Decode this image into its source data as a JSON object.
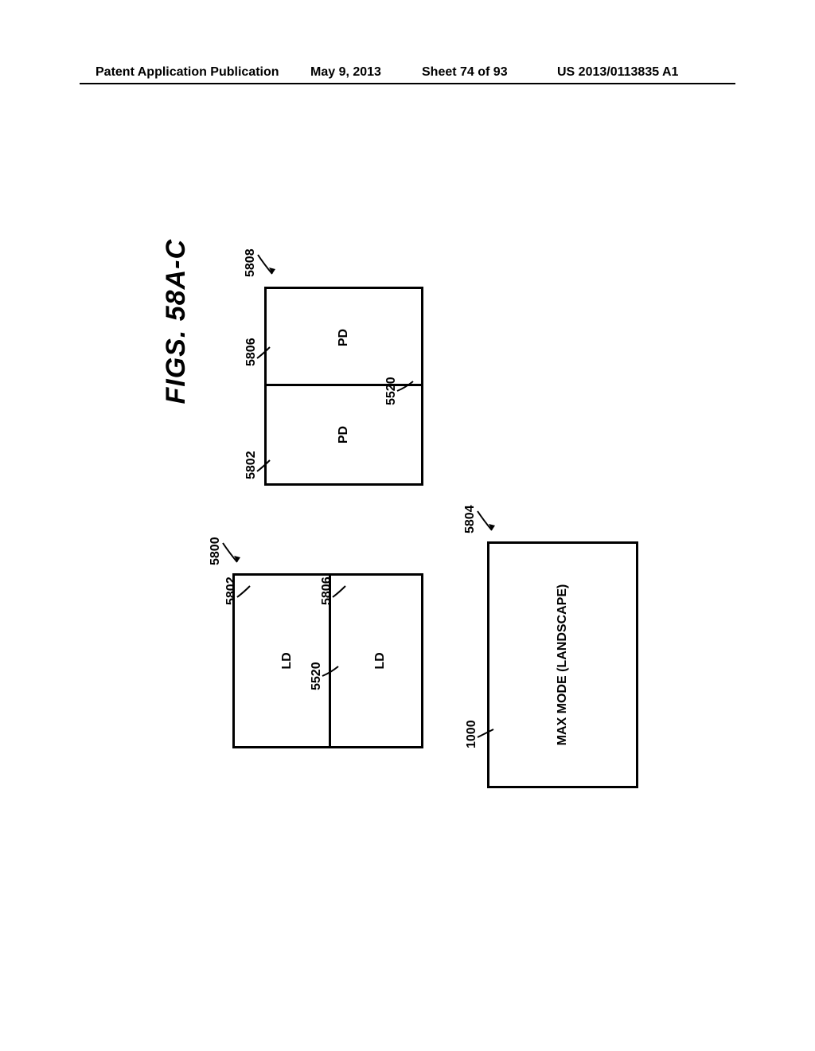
{
  "header": {
    "pub_type": "Patent Application Publication",
    "date": "May 9, 2013",
    "sheet": "Sheet 74 of 93",
    "pub_no": "US 2013/0113835 A1"
  },
  "figure": {
    "title": "FIGS. 58A-C"
  },
  "refs": {
    "r5800": "5800",
    "r5802": "5802",
    "r5804": "5804",
    "r5806": "5806",
    "r5808": "5808",
    "r5520": "5520",
    "r1000": "1000"
  },
  "labels": {
    "ld": "LD",
    "pd": "PD",
    "max": "MAX MODE (LANDSCAPE)"
  }
}
